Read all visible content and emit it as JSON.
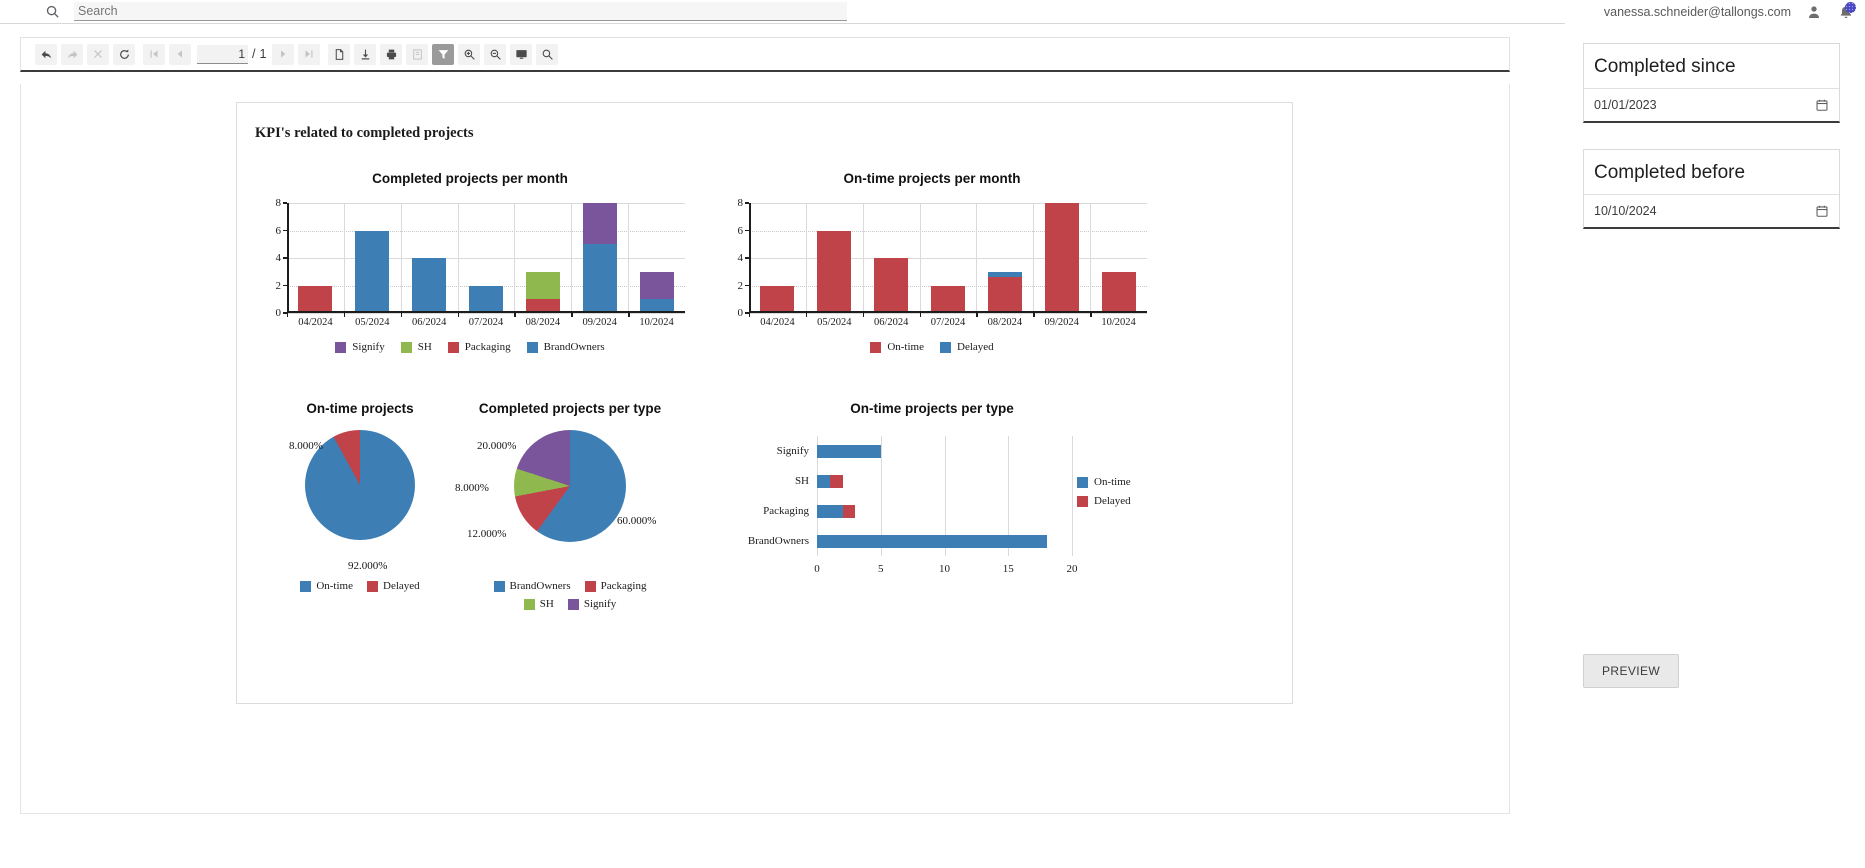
{
  "topbar": {
    "search_placeholder": "Search",
    "search_value": "",
    "search_icon": "search-icon",
    "user_email": "vanessa.schneider@tallongs.com",
    "account_icon": "person-icon",
    "notification_icon": "bell-icon"
  },
  "toolbar": {
    "buttons": [
      {
        "name": "back-button",
        "icon": "arrow-back-icon",
        "state": "enabled"
      },
      {
        "name": "forward-button",
        "icon": "arrow-forward-icon",
        "state": "disabled"
      },
      {
        "name": "stop-button",
        "icon": "close-icon",
        "state": "disabled"
      },
      {
        "name": "refresh-button",
        "icon": "refresh-icon",
        "state": "enabled"
      },
      {
        "name": "first-page-button",
        "icon": "first-page-icon",
        "state": "disabled"
      },
      {
        "name": "previous-page-button",
        "icon": "previous-page-icon",
        "state": "disabled"
      },
      {
        "name": "next-page-button",
        "icon": "next-page-icon",
        "state": "disabled"
      },
      {
        "name": "last-page-button",
        "icon": "last-page-icon",
        "state": "disabled"
      },
      {
        "name": "new-document-button",
        "icon": "document-icon",
        "state": "enabled"
      },
      {
        "name": "export-button",
        "icon": "download-icon",
        "state": "enabled"
      },
      {
        "name": "print-button",
        "icon": "printer-icon",
        "state": "enabled"
      },
      {
        "name": "toc-button",
        "icon": "book-icon",
        "state": "disabled"
      },
      {
        "name": "filter-button",
        "icon": "funnel-icon",
        "state": "active"
      },
      {
        "name": "zoom-in-button",
        "icon": "zoom-in-icon",
        "state": "enabled"
      },
      {
        "name": "zoom-out-button",
        "icon": "zoom-out-icon",
        "state": "enabled"
      },
      {
        "name": "fit-page-button",
        "icon": "monitor-icon",
        "state": "enabled"
      },
      {
        "name": "find-button",
        "icon": "search-icon",
        "state": "enabled"
      }
    ],
    "page_current": "1",
    "page_separator": "/",
    "page_total": "1"
  },
  "report": {
    "title": "KPI's related to completed projects"
  },
  "parameters": {
    "completed_since": {
      "label": "Completed since",
      "value": "01/01/2023",
      "icon": "calendar-icon"
    },
    "completed_before": {
      "label": "Completed before",
      "value": "10/10/2024",
      "icon": "calendar-icon"
    },
    "preview_label": "PREVIEW"
  },
  "colors": {
    "blue": "#3d7fb5",
    "red": "#c0434a",
    "green": "#8fb84e",
    "purple": "#7a559b",
    "axis": "#1d1d1d",
    "grid": "#dadada"
  },
  "chart_data": [
    {
      "id": "completed-projects-per-month",
      "type": "bar",
      "stacked": true,
      "title": "Completed projects per month",
      "xlabel": "",
      "ylabel": "",
      "ylim": [
        0,
        8
      ],
      "yticks": [
        0,
        2,
        4,
        6,
        8
      ],
      "grid": true,
      "legend_position": "bottom",
      "categories": [
        "04/2024",
        "05/2024",
        "06/2024",
        "07/2024",
        "08/2024",
        "09/2024",
        "10/2024"
      ],
      "series": [
        {
          "name": "BrandOwners",
          "color": "#3d7fb5",
          "values": [
            0,
            6,
            4,
            2,
            0,
            5,
            1
          ]
        },
        {
          "name": "Packaging",
          "color": "#c0434a",
          "values": [
            2,
            0,
            0,
            0,
            1,
            0,
            0
          ]
        },
        {
          "name": "SH",
          "color": "#8fb84e",
          "values": [
            0,
            0,
            0,
            0,
            2,
            0,
            0
          ]
        },
        {
          "name": "Signify",
          "color": "#7a559b",
          "values": [
            0,
            0,
            0,
            0,
            0,
            3,
            2
          ]
        }
      ],
      "legend": [
        "Signify",
        "SH",
        "Packaging",
        "BrandOwners"
      ]
    },
    {
      "id": "on-time-projects-per-month",
      "type": "bar",
      "stacked": true,
      "title": "On-time projects per month",
      "xlabel": "",
      "ylabel": "",
      "ylim": [
        0,
        8
      ],
      "yticks": [
        0,
        2,
        4,
        6,
        8
      ],
      "grid": true,
      "legend_position": "bottom",
      "categories": [
        "04/2024",
        "05/2024",
        "06/2024",
        "07/2024",
        "08/2024",
        "09/2024",
        "10/2024"
      ],
      "series": [
        {
          "name": "On-time",
          "color": "#c0434a",
          "values": [
            2,
            6,
            4,
            2,
            2.6,
            8,
            3
          ]
        },
        {
          "name": "Delayed",
          "color": "#3d7fb5",
          "values": [
            0,
            0,
            0,
            0,
            0.4,
            0,
            0
          ]
        }
      ],
      "legend": [
        "On-time",
        "Delayed"
      ]
    },
    {
      "id": "on-time-projects-pie",
      "type": "pie",
      "title": "On-time projects",
      "labels": [
        "On-time",
        "Delayed"
      ],
      "values": [
        92.0,
        8.0
      ],
      "value_labels": [
        "92.000%",
        "8.000%"
      ],
      "colors": [
        "#3d7fb5",
        "#c0434a"
      ],
      "legend_position": "bottom"
    },
    {
      "id": "completed-projects-per-type-pie",
      "type": "pie",
      "title": "Completed projects per type",
      "labels": [
        "BrandOwners",
        "Packaging",
        "SH",
        "Signify"
      ],
      "values": [
        60.0,
        12.0,
        8.0,
        20.0
      ],
      "value_labels": [
        "60.000%",
        "12.000%",
        "8.000%",
        "20.000%"
      ],
      "colors": [
        "#3d7fb5",
        "#c0434a",
        "#8fb84e",
        "#7a559b"
      ],
      "legend_position": "bottom"
    },
    {
      "id": "on-time-projects-per-type",
      "type": "bar",
      "orientation": "horizontal",
      "stacked": true,
      "title": "On-time projects per type",
      "categories": [
        "Signify",
        "SH",
        "Packaging",
        "BrandOwners"
      ],
      "xlim": [
        0,
        20
      ],
      "xticks": [
        0,
        5,
        10,
        15,
        20
      ],
      "grid": true,
      "legend_position": "right",
      "series": [
        {
          "name": "On-time",
          "color": "#3d7fb5",
          "values": [
            5,
            1,
            2,
            18
          ]
        },
        {
          "name": "Delayed",
          "color": "#c0434a",
          "values": [
            0,
            1,
            1,
            0
          ]
        }
      ],
      "legend": [
        "On-time",
        "Delayed"
      ]
    }
  ]
}
